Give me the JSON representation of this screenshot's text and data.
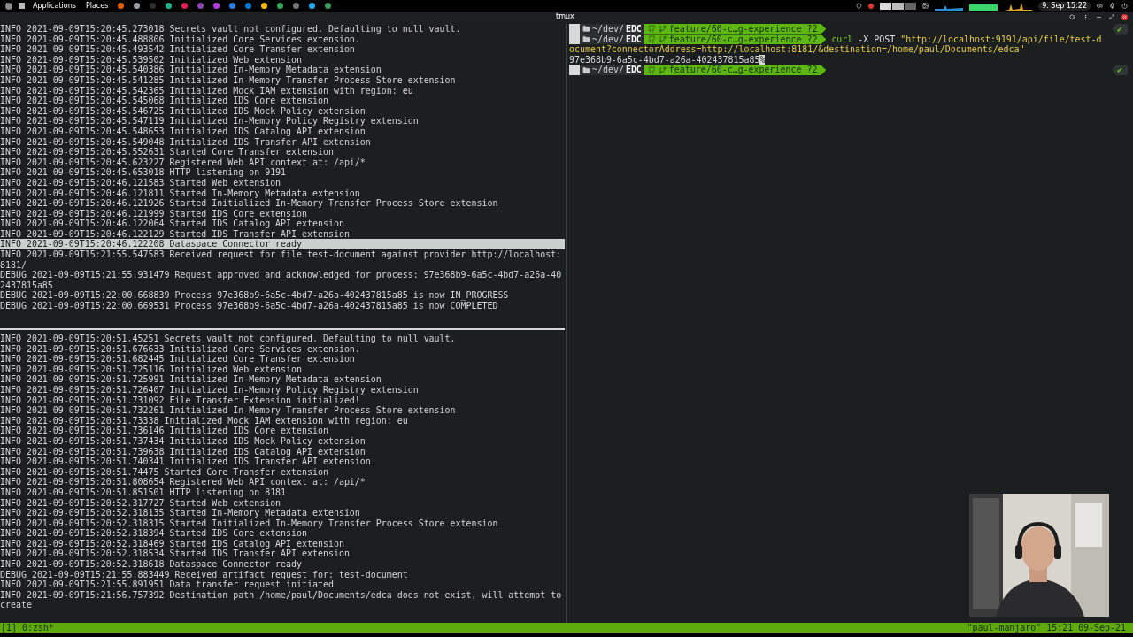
{
  "top_panel": {
    "menus": [
      "Applications",
      "Places"
    ],
    "clock": "9. Sep 15:22"
  },
  "window": {
    "title": "tmux"
  },
  "top_pane": {
    "lines": [
      {
        "text": "INFO 2021-09-09T15:20:45.273018 Secrets vault not configured. Defaulting to null vault.",
        "highlighted": false
      },
      {
        "text": "INFO 2021-09-09T15:20:45.488806 Initialized Core Services extension.",
        "highlighted": false
      },
      {
        "text": "INFO 2021-09-09T15:20:45.493542 Initialized Core Transfer extension",
        "highlighted": false
      },
      {
        "text": "INFO 2021-09-09T15:20:45.539502 Initialized Web extension",
        "highlighted": false
      },
      {
        "text": "INFO 2021-09-09T15:20:45.540386 Initialized In-Memory Metadata extension",
        "highlighted": false
      },
      {
        "text": "INFO 2021-09-09T15:20:45.541285 Initialized In-Memory Transfer Process Store extension",
        "highlighted": false
      },
      {
        "text": "INFO 2021-09-09T15:20:45.542365 Initialized Mock IAM extension with region: eu",
        "highlighted": false
      },
      {
        "text": "INFO 2021-09-09T15:20:45.545068 Initialized IDS Core extension",
        "highlighted": false
      },
      {
        "text": "INFO 2021-09-09T15:20:45.546725 Initialized IDS Mock Policy extension",
        "highlighted": false
      },
      {
        "text": "INFO 2021-09-09T15:20:45.547119 Initialized In-Memory Policy Registry extension",
        "highlighted": false
      },
      {
        "text": "INFO 2021-09-09T15:20:45.548653 Initialized IDS Catalog API extension",
        "highlighted": false
      },
      {
        "text": "INFO 2021-09-09T15:20:45.549048 Initialized IDS Transfer API extension",
        "highlighted": false
      },
      {
        "text": "INFO 2021-09-09T15:20:45.552631 Started Core Transfer extension",
        "highlighted": false
      },
      {
        "text": "INFO 2021-09-09T15:20:45.623227 Registered Web API context at: /api/*",
        "highlighted": false
      },
      {
        "text": "INFO 2021-09-09T15:20:45.653018 HTTP listening on 9191",
        "highlighted": false
      },
      {
        "text": "INFO 2021-09-09T15:20:46.121583 Started Web extension",
        "highlighted": false
      },
      {
        "text": "INFO 2021-09-09T15:20:46.121811 Started In-Memory Metadata extension",
        "highlighted": false
      },
      {
        "text": "INFO 2021-09-09T15:20:46.121926 Started Initialized In-Memory Transfer Process Store extension",
        "highlighted": false
      },
      {
        "text": "INFO 2021-09-09T15:20:46.121999 Started IDS Core extension",
        "highlighted": false
      },
      {
        "text": "INFO 2021-09-09T15:20:46.122064 Started IDS Catalog API extension",
        "highlighted": false
      },
      {
        "text": "INFO 2021-09-09T15:20:46.122129 Started IDS Transfer API extension",
        "highlighted": false
      },
      {
        "text": "INFO 2021-09-09T15:20:46.122208 Dataspace Connector ready",
        "highlighted": true
      },
      {
        "text": "INFO 2021-09-09T15:21:55.547583 Received request for file test-document against provider http://localhost:8181/",
        "highlighted": false
      },
      {
        "text": "DEBUG 2021-09-09T15:21:55.931479 Request approved and acknowledged for process: 97e368b9-6a5c-4bd7-a26a-402437815a85",
        "highlighted": false
      },
      {
        "text": "DEBUG 2021-09-09T15:22:00.668839 Process 97e368b9-6a5c-4bd7-a26a-402437815a85 is now IN_PROGRESS",
        "highlighted": false
      },
      {
        "text": "DEBUG 2021-09-09T15:22:00.669531 Process 97e368b9-6a5c-4bd7-a26a-402437815a85 is now COMPLETED",
        "highlighted": false
      }
    ]
  },
  "bottom_pane": {
    "lines": [
      {
        "text": "INFO 2021-09-09T15:20:51.45251 Secrets vault not configured. Defaulting to null vault.",
        "highlighted": false
      },
      {
        "text": "INFO 2021-09-09T15:20:51.676633 Initialized Core Services extension.",
        "highlighted": false
      },
      {
        "text": "INFO 2021-09-09T15:20:51.682445 Initialized Core Transfer extension",
        "highlighted": false
      },
      {
        "text": "INFO 2021-09-09T15:20:51.725116 Initialized Web extension",
        "highlighted": false
      },
      {
        "text": "INFO 2021-09-09T15:20:51.725991 Initialized In-Memory Metadata extension",
        "highlighted": false
      },
      {
        "text": "INFO 2021-09-09T15:20:51.726407 Initialized In-Memory Policy Registry extension",
        "highlighted": false
      },
      {
        "text": "INFO 2021-09-09T15:20:51.731092 File Transfer Extension initialized!",
        "highlighted": false
      },
      {
        "text": "INFO 2021-09-09T15:20:51.732261 Initialized In-Memory Transfer Process Store extension",
        "highlighted": false
      },
      {
        "text": "INFO 2021-09-09T15:20:51.73338 Initialized Mock IAM extension with region: eu",
        "highlighted": false
      },
      {
        "text": "INFO 2021-09-09T15:20:51.736146 Initialized IDS Core extension",
        "highlighted": false
      },
      {
        "text": "INFO 2021-09-09T15:20:51.737434 Initialized IDS Mock Policy extension",
        "highlighted": false
      },
      {
        "text": "INFO 2021-09-09T15:20:51.739638 Initialized IDS Catalog API extension",
        "highlighted": false
      },
      {
        "text": "INFO 2021-09-09T15:20:51.740341 Initialized IDS Transfer API extension",
        "highlighted": false
      },
      {
        "text": "INFO 2021-09-09T15:20:51.74475 Started Core Transfer extension",
        "highlighted": false
      },
      {
        "text": "INFO 2021-09-09T15:20:51.808654 Registered Web API context at: /api/*",
        "highlighted": false
      },
      {
        "text": "INFO 2021-09-09T15:20:51.851501 HTTP listening on 8181",
        "highlighted": false
      },
      {
        "text": "INFO 2021-09-09T15:20:52.317727 Started Web extension",
        "highlighted": false
      },
      {
        "text": "INFO 2021-09-09T15:20:52.318135 Started In-Memory Metadata extension",
        "highlighted": false
      },
      {
        "text": "INFO 2021-09-09T15:20:52.318315 Started Initialized In-Memory Transfer Process Store extension",
        "highlighted": false
      },
      {
        "text": "INFO 2021-09-09T15:20:52.318394 Started IDS Core extension",
        "highlighted": false
      },
      {
        "text": "INFO 2021-09-09T15:20:52.318469 Started IDS Catalog API extension",
        "highlighted": false
      },
      {
        "text": "INFO 2021-09-09T15:20:52.318534 Started IDS Transfer API extension",
        "highlighted": false
      },
      {
        "text": "INFO 2021-09-09T15:20:52.318618 Dataspace Connector ready",
        "highlighted": false
      },
      {
        "text": "DEBUG 2021-09-09T15:21:55.883449 Received artifact request for: test-document",
        "highlighted": false
      },
      {
        "text": "INFO 2021-09-09T15:21:55.891951 Data transfer request initiated",
        "highlighted": false
      },
      {
        "text": "INFO 2021-09-09T15:21:56.757392 Destination path /home/paul/Documents/edca does not exist, will attempt to create",
        "highlighted": false
      }
    ]
  },
  "right_pane": {
    "lines": [
      {
        "kind": "prompt",
        "path": "~/dev/",
        "dir": "EDC",
        "branch": "feature/60-c…g-experience ?2",
        "status": "✔"
      },
      {
        "kind": "prompt",
        "path": "~/dev/",
        "dir": "EDC",
        "branch": "feature/60-c…g-experience ?2",
        "command": "curl",
        "args": "-X POST",
        "string": "\"http://localhost:9191/api/file/test-d"
      },
      {
        "kind": "continuation",
        "text": "ocument?connectorAddress=http://localhost:8181/&destination=/home/paul/Documents/edca\""
      },
      {
        "kind": "output",
        "text": "97e368b9-6a5c-4bd7-a26a-402437815a85",
        "mark": "%"
      },
      {
        "kind": "prompt",
        "path": "~/dev/",
        "dir": "EDC",
        "branch": "feature/60-c…g-experience ?2",
        "status": "✔"
      }
    ]
  },
  "status_bar": {
    "window": "[1] 0:zsh*",
    "host": "\"paul-manjaro\" 15:21 09-Sep-21"
  }
}
